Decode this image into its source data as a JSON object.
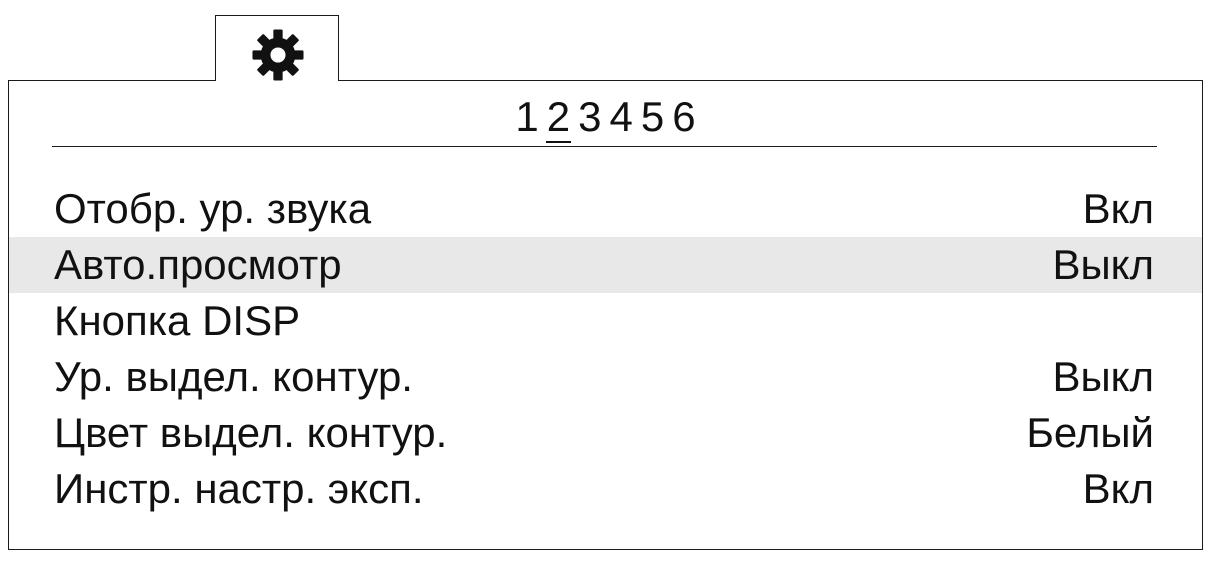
{
  "tab": {
    "icon": "gear-icon"
  },
  "pagination": {
    "pages": [
      "1",
      "2",
      "3",
      "4",
      "5",
      "6"
    ],
    "current": "2"
  },
  "menu": {
    "items": [
      {
        "label": "Отобр. ур. звука",
        "value": "Вкл"
      },
      {
        "label": "Авто.просмотр",
        "value": "Выкл"
      },
      {
        "label": "Кнопка DISP",
        "value": ""
      },
      {
        "label": "Ур. выдел. контур.",
        "value": "Выкл"
      },
      {
        "label": "Цвет выдел. контур.",
        "value": "Белый"
      },
      {
        "label": "Инстр. настр. эксп.",
        "value": "Вкл"
      }
    ],
    "selected_index": 1
  },
  "colors": {
    "border": "#1a1a1a",
    "selected_row": "#e8e8e8",
    "text": "#111111"
  }
}
